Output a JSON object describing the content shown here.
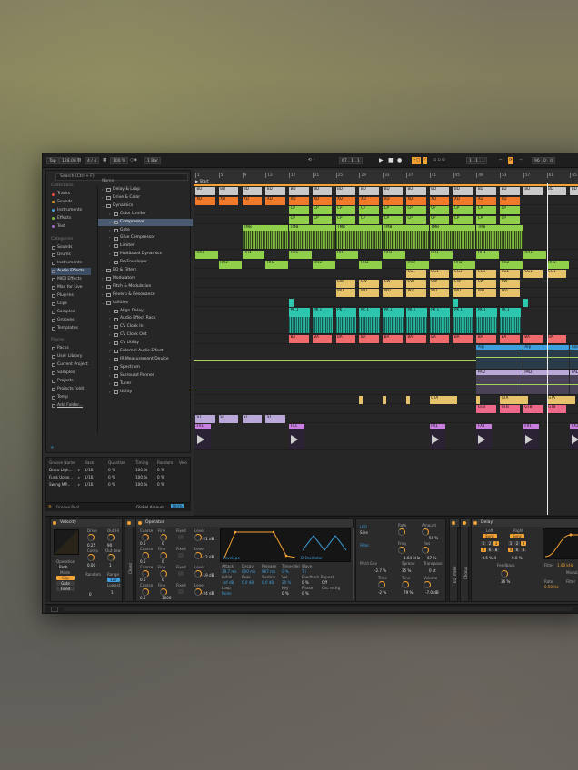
{
  "topbar": {
    "tap": "Tap",
    "tempo": "128.00",
    "sig": "4 / 4",
    "zoom": "100 %",
    "bar": "1 Bar",
    "pos": "67 .  1 .  1",
    "loopstart": "1 .  1 .  1",
    "looplen": "96 .  0 .  0"
  },
  "browser": {
    "search_placeholder": "Search (Ctrl + F)",
    "collections_title": "Collections",
    "collections": [
      {
        "label": "Tracks",
        "color": "#e5513b"
      },
      {
        "label": "Sounds",
        "color": "#f3a233"
      },
      {
        "label": "Instruments",
        "color": "#3d9fdb"
      },
      {
        "label": "Effects",
        "color": "#7dbb3a"
      },
      {
        "label": "Test",
        "color": "#9e6bd4"
      }
    ],
    "categories_title": "Categories",
    "categories": [
      "Sounds",
      "Drums",
      "Instruments",
      "Audio Effects",
      "MIDI Effects",
      "Max for Live",
      "Plug-Ins",
      "Clips",
      "Samples",
      "Grooves",
      "Templates"
    ],
    "places_title": "Places",
    "places": [
      "Packs",
      "User Library",
      "Current Project",
      "Samples",
      "Projects",
      "Projects (old)",
      "Temp",
      "Add Folder..."
    ],
    "name_header": "Name",
    "files": [
      {
        "label": "Delay & Loop",
        "level": 0,
        "arrow": "›"
      },
      {
        "label": "Drive & Color",
        "level": 0,
        "arrow": "›"
      },
      {
        "label": "Dynamics",
        "level": 0,
        "arrow": "⌄"
      },
      {
        "label": "Color Limiter",
        "level": 1,
        "arrow": "›"
      },
      {
        "label": "Compressor",
        "level": 1,
        "arrow": "›",
        "selected": true
      },
      {
        "label": "Gate",
        "level": 1,
        "arrow": "›"
      },
      {
        "label": "Glue Compressor",
        "level": 1,
        "arrow": "›"
      },
      {
        "label": "Limiter",
        "level": 1,
        "arrow": "›"
      },
      {
        "label": "Multiband Dynamics",
        "level": 1,
        "arrow": "›"
      },
      {
        "label": "Re-Enveloper",
        "level": 1,
        "arrow": "›"
      },
      {
        "label": "EQ & Filters",
        "level": 0,
        "arrow": "›"
      },
      {
        "label": "Modulators",
        "level": 0,
        "arrow": "›"
      },
      {
        "label": "Pitch & Modulation",
        "level": 0,
        "arrow": "›"
      },
      {
        "label": "Reverb & Resonance",
        "level": 0,
        "arrow": "›"
      },
      {
        "label": "Utilities",
        "level": 0,
        "arrow": "⌄"
      },
      {
        "label": "Align Delay",
        "level": 1,
        "arrow": "›"
      },
      {
        "label": "Audio Effect Rack",
        "level": 1,
        "arrow": "›"
      },
      {
        "label": "CV Clock In",
        "level": 1,
        "arrow": "›"
      },
      {
        "label": "CV Clock Out",
        "level": 1,
        "arrow": "›"
      },
      {
        "label": "CV Utility",
        "level": 1,
        "arrow": "›"
      },
      {
        "label": "External Audio Effect",
        "level": 1,
        "arrow": "›"
      },
      {
        "label": "IR Measurement Device",
        "level": 1,
        "arrow": "›"
      },
      {
        "label": "Spectrum",
        "level": 1,
        "arrow": "›"
      },
      {
        "label": "Surround Panner",
        "level": 1,
        "arrow": "›"
      },
      {
        "label": "Tuner",
        "level": 1,
        "arrow": "›"
      },
      {
        "label": "Utility",
        "level": 1,
        "arrow": "›"
      }
    ]
  },
  "groove": {
    "headers": [
      "Groove Name",
      "Base",
      "Quantize",
      "Timing",
      "Random",
      "Velo"
    ],
    "rows": [
      [
        "Disco Ligh...",
        "1/16",
        "0 %",
        "100 %",
        "0 %"
      ],
      [
        "Funk Upbe...",
        "1/16",
        "0 %",
        "100 %",
        "0 %"
      ],
      [
        "Swing MP...",
        "1/16",
        "0 %",
        "100 %",
        "0 %"
      ]
    ],
    "pool_label": "Groove Pool",
    "amount_label": "Global Amount",
    "amount": "100%"
  },
  "arrangement": {
    "ruler": [
      "1",
      "5",
      "9",
      "13",
      "17",
      "21",
      "25",
      "29",
      "33",
      "37",
      "41",
      "45",
      "49",
      "53",
      "57",
      "61",
      "65"
    ],
    "start_marker": "Start",
    "timeline": [
      "0:00",
      "0:15",
      "0:30",
      "0:45",
      "1:00",
      "1:15",
      "1:30",
      "1:45",
      "2:00"
    ],
    "labels": {
      "bd": "BD",
      "xd": "XD",
      "cp": "CP",
      "tmb": "TMB",
      "hh1": "HH1",
      "hh2": "HH2",
      "cg1": "CG1",
      "cg2": "CG2",
      "cg3": "CG3",
      "cw": "CW",
      "wd": "WD",
      "hwd": "H-WD",
      "pk1": "PK 1",
      "ba": "BA",
      "arp": "Arp",
      "pad": "PAD",
      "gta": "GTA",
      "gtb": "GTB",
      "st": "ST",
      "fx1": "FX1"
    }
  },
  "devices": {
    "velocity": {
      "title": "Velocity",
      "drive": "Drive",
      "outhi": "Out Hi",
      "drive_val": "0.25",
      "outhi_val": "90",
      "comp": "Comp",
      "outlow": "Out Low",
      "comp_val": "0.00",
      "outlow_val": "1",
      "operation": "Operation",
      "op_val": "Both",
      "mode": "Mode",
      "clip": "Clip",
      "gate": "Gate",
      "fixed": "Fixed",
      "random": "Random",
      "random_val": "0",
      "range": "Range",
      "range_val": "127",
      "lowest": "Lowest",
      "lowest_val": "1"
    },
    "chord": "Chord",
    "operator": {
      "title": "Operator",
      "coarse": "Coarse",
      "fine": "Fine",
      "fixed": "Fixed",
      "level": "Level",
      "levels": [
        "-21 dB",
        "-12 dB",
        "-19 dB",
        "-24 dB"
      ],
      "coarse_vals": [
        "0.5",
        "0.5",
        "0.5",
        "0.5"
      ],
      "fine_vals": [
        "0",
        "0",
        "0",
        "1000"
      ],
      "env": "Envelope",
      "osc": "D Oscillator",
      "attack": "Attack",
      "decay": "Decay",
      "release": "Release",
      "timevel": "Time<Vel",
      "wave": "Wave",
      "attack_v": "29.7 ms",
      "decay_v": "600 ms",
      "release_v": "967 ms",
      "timevel_v": "0 %",
      "wave_v": "Tri",
      "initial": "Initial",
      "peak": "Peak",
      "sustain": "Sustain",
      "vel": "Vel",
      "fbrep": "Feedback Repeat",
      "initial_v": "-inf dB",
      "peak_v": "0.0 dB",
      "sustain_v": "0.0 dB",
      "vel_v": "20 %",
      "fb_v": "0 %",
      "rep_v": "Off",
      "loop": "Loop",
      "loop_v": "None",
      "key": "Key",
      "key_v": "0 %",
      "phase": "Phase",
      "phase_v": "0 %",
      "osc_retrig": "Osc retrig",
      "lfo": "LFO",
      "lfo_wave": "Sine",
      "lfo_rate": "Rate",
      "lfo_amount": "Amount",
      "lfo_amount_v": "50 %",
      "filter": "Filter",
      "filter_freq": "Freq",
      "filter_freq_v": "1.64 kHz",
      "filter_res": "Res",
      "filter_res_v": "67 %",
      "pitchenv": "Pitch Env",
      "pitchenv_v": "-2.7 %",
      "spread": "Spread",
      "spread_v": "35 %",
      "transpose": "Transpose",
      "transpose_v": "0 st",
      "time": "Time",
      "time_v": "-2 %",
      "tone": "Tone",
      "tone_v": "79 %",
      "volume": "Volume",
      "volume_v": "-7.0 dB"
    },
    "eqthree": "EQ Three",
    "chorus": "Chorus",
    "delay": {
      "title": "Delay",
      "left": "Left",
      "right": "Right",
      "sync": "Sync",
      "nums": [
        "1",
        "2",
        "3",
        "4",
        "6",
        "8",
        "16"
      ],
      "feedback": "Feedback",
      "feedback_v": "36 %",
      "left_v": "-0.5 % 4",
      "right_v": "0.0 %",
      "filter": "Filter",
      "filter_v": "1.00 kHz",
      "modulation": "Modulat...",
      "rate": "Rate",
      "rate_v": "0.50 Hz",
      "filter_lbl": "Filter"
    }
  }
}
